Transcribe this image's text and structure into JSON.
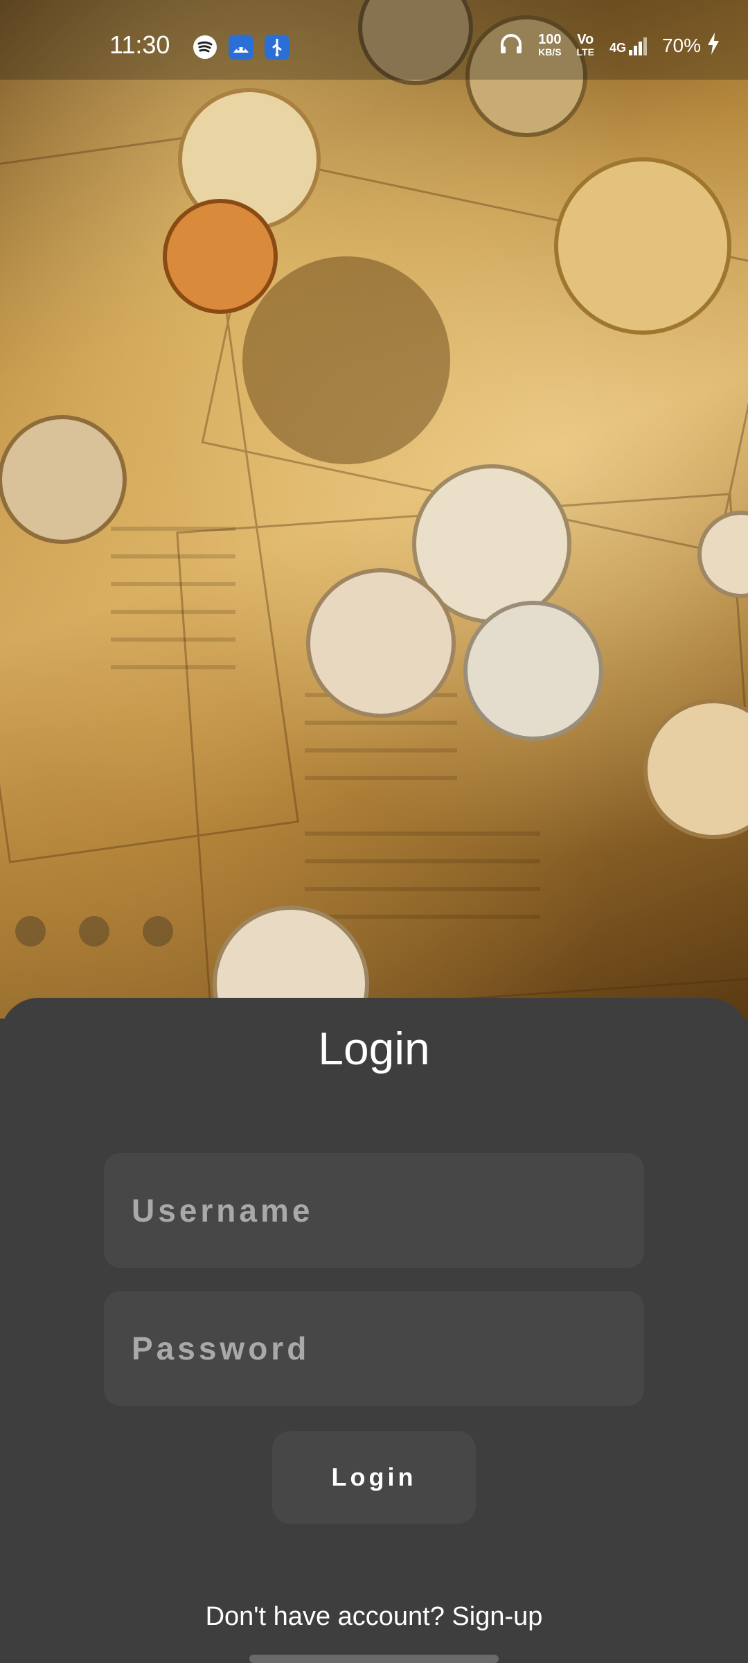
{
  "status_bar": {
    "time": "11:30",
    "net_speed_value": "100",
    "net_speed_unit": "KB/S",
    "volte": "Vo",
    "volte_sub": "LTE",
    "network": "4G",
    "battery": "70%",
    "icons": [
      "spotify-icon",
      "android-icon",
      "usb-icon",
      "headphones-icon",
      "signal-icon",
      "charging-icon"
    ]
  },
  "login": {
    "title": "Login",
    "username_placeholder": "Username",
    "password_placeholder": "Password",
    "button_label": "Login",
    "signup_text": "Don't have account? Sign-up"
  },
  "colors": {
    "sheet_background": "#3e3e3e",
    "field_background": "#474747",
    "placeholder_text": "#a9a9a9",
    "text": "#ffffff"
  }
}
